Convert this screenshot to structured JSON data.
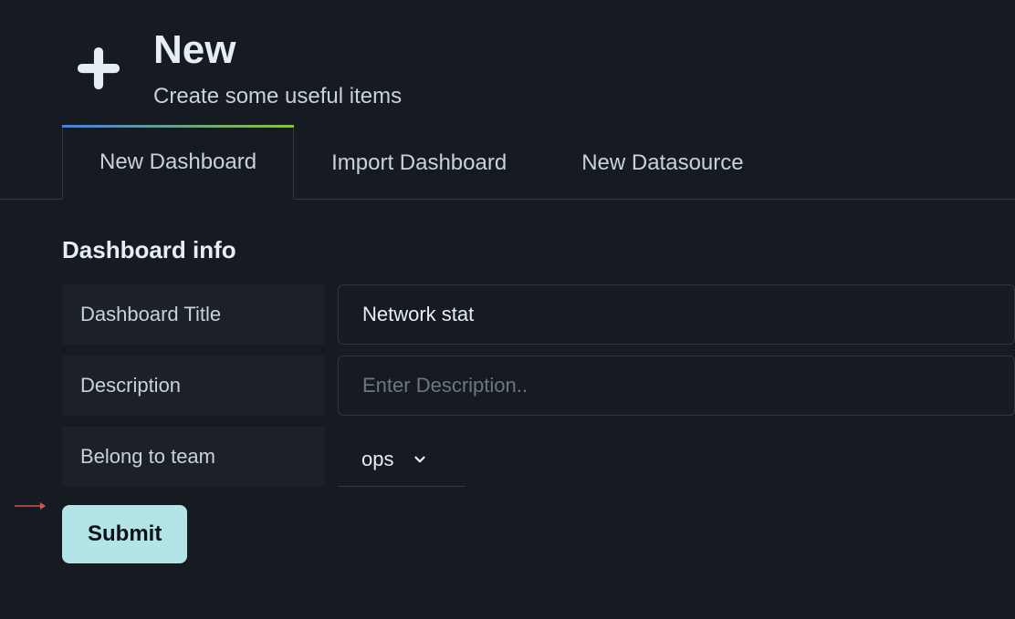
{
  "header": {
    "title": "New",
    "subtitle": "Create some useful items"
  },
  "tabs": [
    {
      "label": "New Dashboard",
      "active": true
    },
    {
      "label": "Import Dashboard",
      "active": false
    },
    {
      "label": "New Datasource",
      "active": false
    }
  ],
  "section": {
    "title": "Dashboard info"
  },
  "form": {
    "title_label": "Dashboard Title",
    "title_value": "Network stat",
    "description_label": "Description",
    "description_placeholder": "Enter Description..",
    "description_value": "",
    "team_label": "Belong to team",
    "team_value": "ops"
  },
  "submit_label": "Submit"
}
